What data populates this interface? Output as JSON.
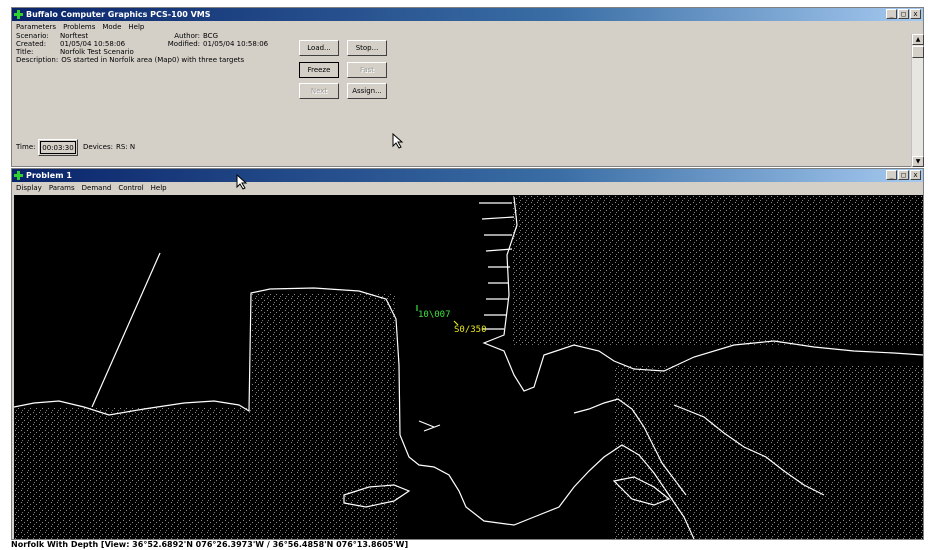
{
  "main_window": {
    "title": "Buffalo Computer Graphics PCS-100 VMS",
    "caption_buttons": {
      "minimize": "_",
      "maximize": "□",
      "close": "x"
    },
    "menu": [
      "Parameters",
      "Problems",
      "Mode",
      "Help"
    ],
    "scenario_label": "Scenario:",
    "scenario_value": "Norftest",
    "created_label": "Created:",
    "created_value": "01/05/04 10:58:06",
    "title_label": "Title:",
    "title_value": "Norfolk Test Scenario",
    "description_label": "Description:",
    "description_value": "OS started in Norfolk area (Map0) with three targets",
    "author_label": "Author:",
    "author_value": "BCG",
    "modified_label": "Modified:",
    "modified_value": "01/05/04 10:58:06",
    "buttons": {
      "load": "Load...",
      "stop": "Stop...",
      "freeze": "Freeze",
      "fast": "Fast",
      "next": "Next",
      "assign": "Assign..."
    },
    "time_label": "Time:",
    "time_value": "00:03:30",
    "devices_label": "Devices:",
    "devices_value": "RS:  N"
  },
  "problem_window": {
    "title": "Problem 1",
    "menu": [
      "Display",
      "Params",
      "Demand",
      "Control",
      "Help"
    ],
    "targets": [
      {
        "label": "10\\007",
        "color": "#3fe03f"
      },
      {
        "label": "S0/350",
        "color": "#e8e820"
      }
    ]
  },
  "status_bar": {
    "text": "Norfolk With Depth  [View:  36°52.6892'N  076°26.3973'W  /  36°56.4858'N  076°13.8605'W]"
  },
  "colors": {
    "titlebar": "#0a246a",
    "map_background": "#000000",
    "coastline": "#ffffff",
    "target_green": "#3fe03f",
    "target_yellow": "#e8e820"
  }
}
